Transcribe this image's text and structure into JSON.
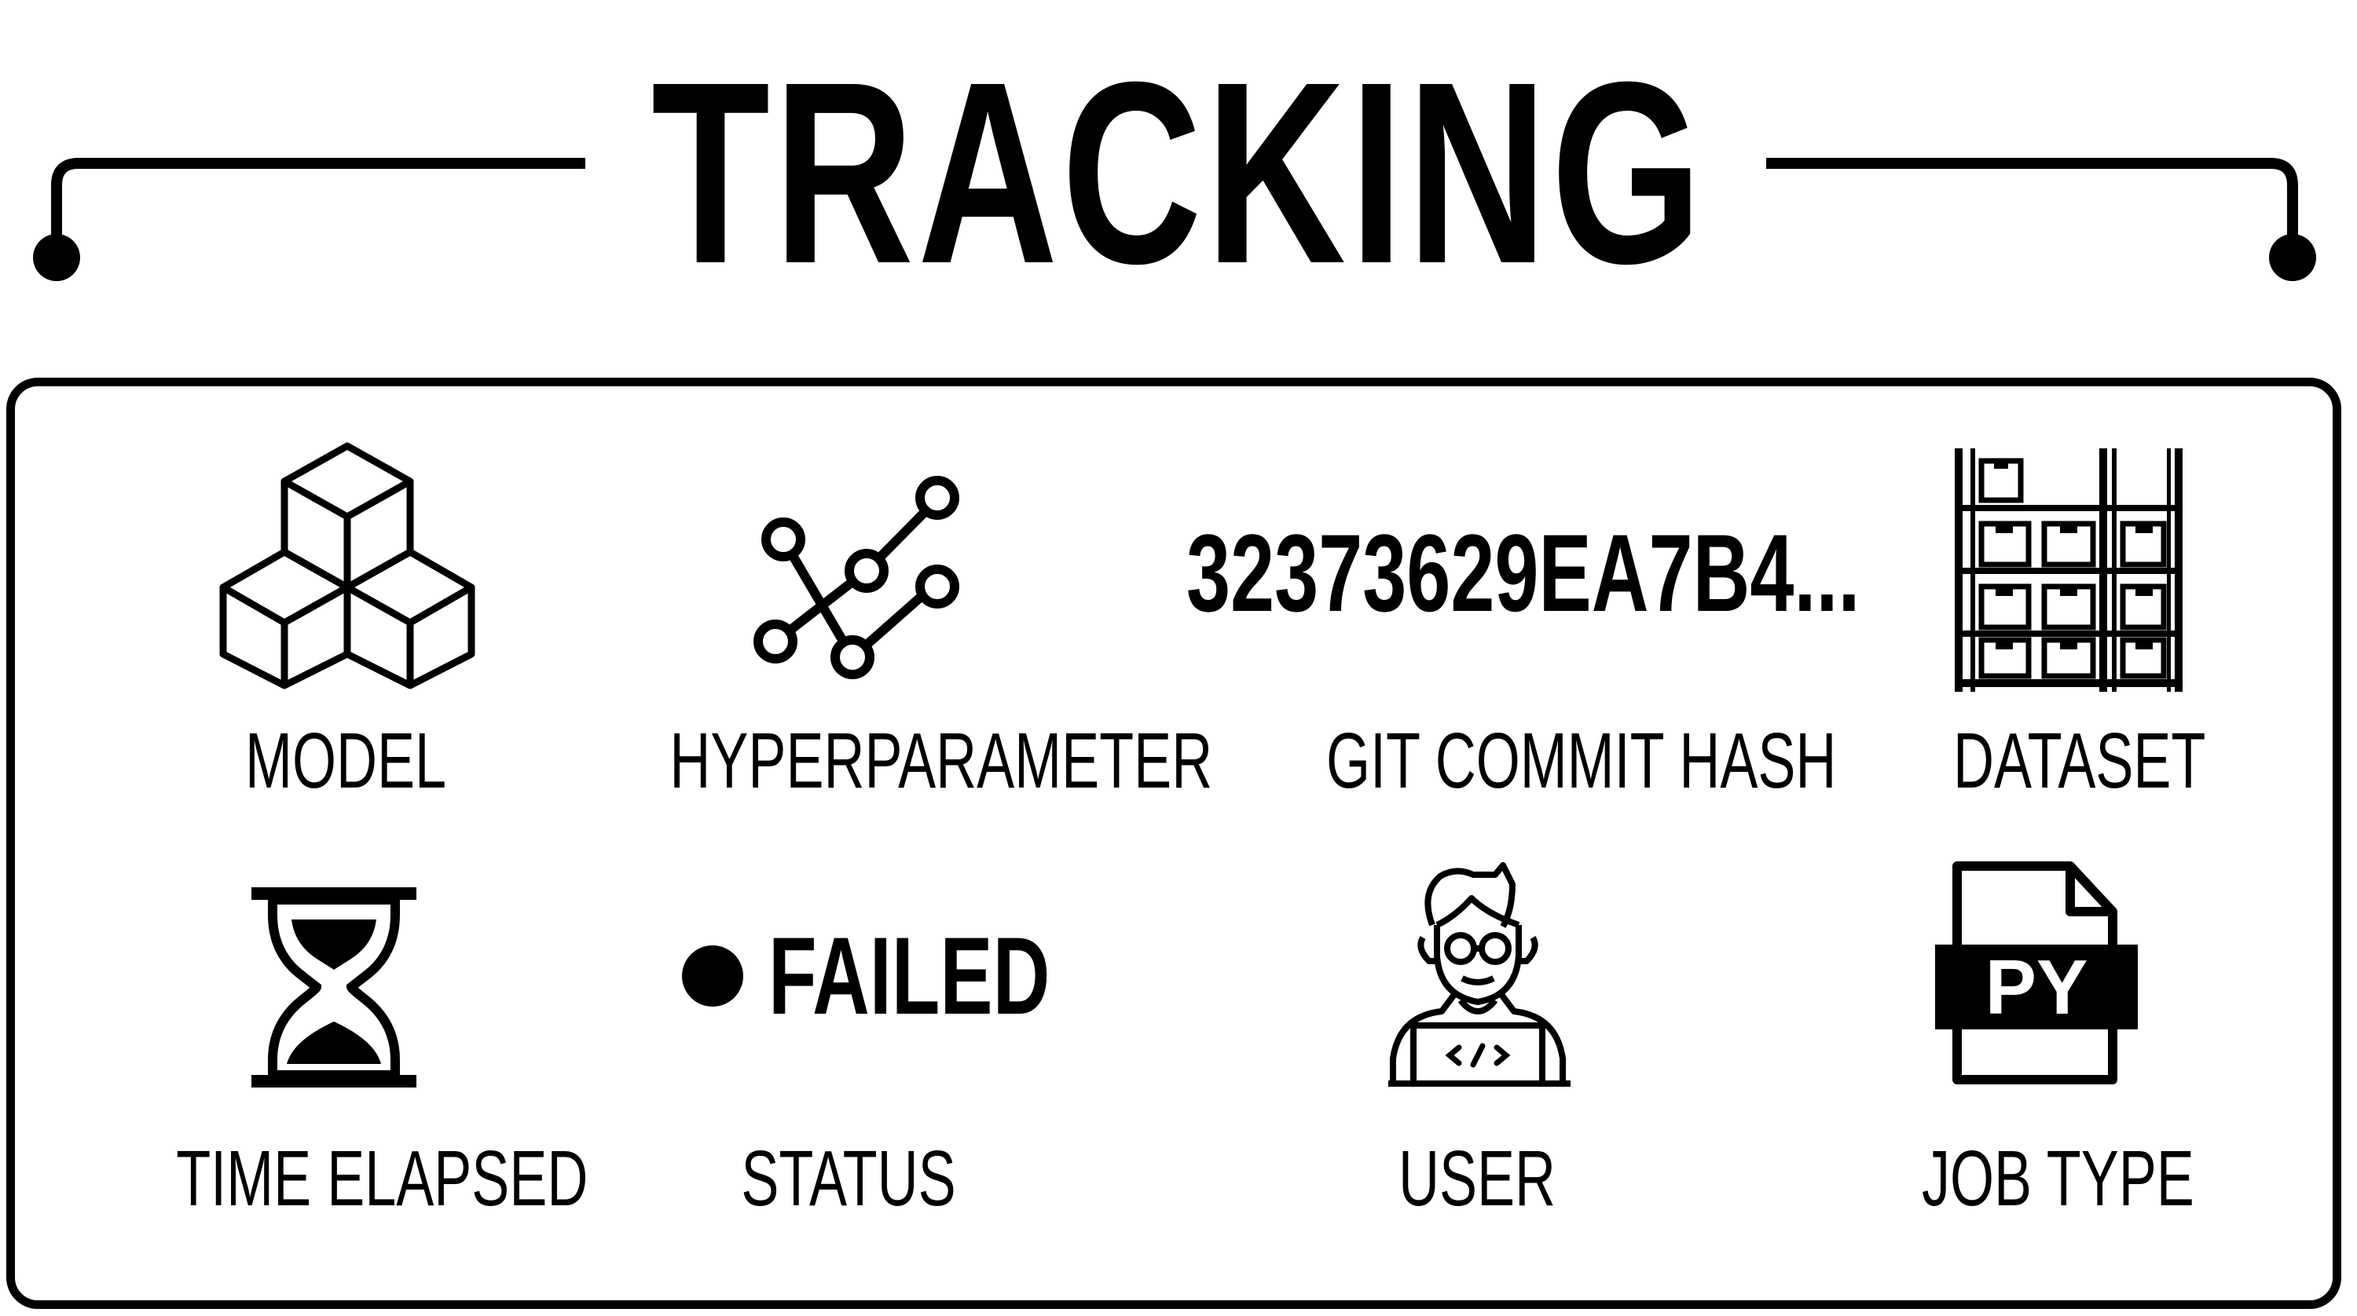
{
  "title": "TRACKING",
  "items": [
    {
      "label": "MODEL",
      "icon": "cubes-icon"
    },
    {
      "label": "HYPERPARAMETER",
      "icon": "graph-nodes-icon"
    },
    {
      "label": "GIT COMMIT HASH",
      "value": "32373629EA7B4..."
    },
    {
      "label": "DATASET",
      "icon": "storage-shelves-icon"
    },
    {
      "label": "TIME ELAPSED",
      "icon": "hourglass-icon"
    },
    {
      "label": "STATUS",
      "value": "FAILED",
      "icon": "status-dot-icon"
    },
    {
      "label": "USER",
      "icon": "developer-icon"
    },
    {
      "label": "JOB TYPE",
      "icon": "py-file-icon",
      "icon_text": "PY"
    }
  ]
}
